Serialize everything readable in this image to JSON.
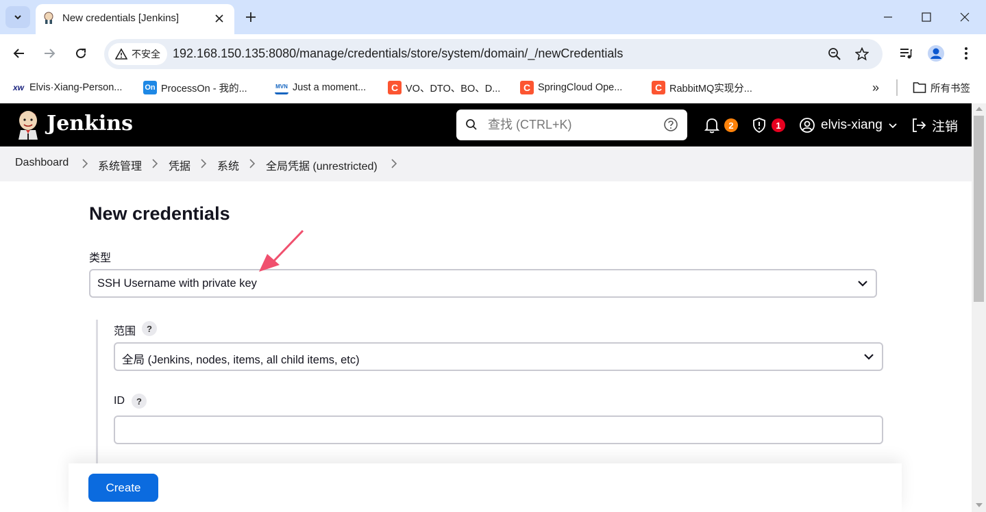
{
  "browser": {
    "tab_title": "New credentials [Jenkins]",
    "new_tab": "+",
    "security_label": "不安全",
    "url": "192.168.150.135:8080/manage/credentials/store/system/domain/_/newCredentials",
    "bookmarks": [
      {
        "icon": "xw",
        "label": "Elvis·Xiang-Person..."
      },
      {
        "icon": "On",
        "label": "ProcessOn - 我的..."
      },
      {
        "icon": "MVN",
        "label": "Just a moment..."
      },
      {
        "icon": "C",
        "label": "VO、DTO、BO、D..."
      },
      {
        "icon": "C",
        "label": "SpringCloud Ope..."
      },
      {
        "icon": "C",
        "label": "RabbitMQ实现分..."
      }
    ],
    "bookmarks_overflow": "»",
    "all_bookmarks": "所有书签"
  },
  "jenkins": {
    "title": "Jenkins",
    "search_placeholder": "查找 (CTRL+K)",
    "notifications_count": "2",
    "security_count": "1",
    "username": "elvis-xiang",
    "logout": "注销"
  },
  "breadcrumb": [
    "Dashboard",
    "系统管理",
    "凭据",
    "系统",
    "全局凭据 (unrestricted)"
  ],
  "form": {
    "title": "New credentials",
    "kind_label": "类型",
    "kind_value": "SSH Username with private key",
    "scope_label": "范围",
    "scope_value": "全局 (Jenkins, nodes, items, all child items, etc)",
    "id_label": "ID",
    "id_value": "",
    "help": "?",
    "create_label": "Create"
  },
  "colors": {
    "tabstrip": "#d3e3fd",
    "jenkins_header": "#000000",
    "notification_badge": "#fe820a",
    "security_badge": "#e6001f",
    "primary_button": "#0b6bdf",
    "annotation_arrow": "#f0506e"
  }
}
